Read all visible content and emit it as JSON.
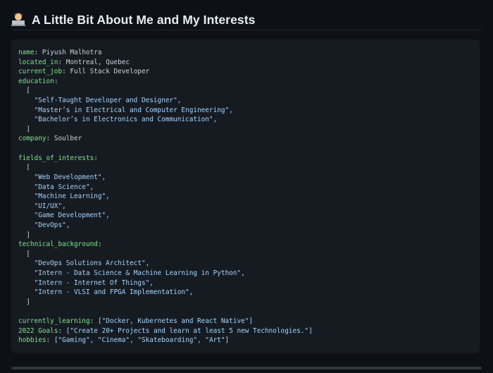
{
  "heading": {
    "emoji": "technologist-emoji",
    "title": "A Little Bit About Me and My Interests"
  },
  "code": {
    "name_key": "name",
    "name_value": "Piyush Malhotra",
    "located_key": "located_in",
    "located_value": "Montreal, Quebec",
    "job_key": "current_job",
    "job_value": "Full Stack Developer",
    "education_key": "education",
    "education": [
      "\"Self-Taught Developer and Designer\",",
      "\"Master’s in Electrical and Computer Engineering\",",
      "\"Bachelor’s in Electronics and Communication\","
    ],
    "company_key": "company",
    "company_value": "Soulber",
    "interests_key": "fields_of_interests",
    "interests": [
      "\"Web Development\",",
      "\"Data Science\",",
      "\"Machine Learning\",",
      "\"UI/UX\",",
      "\"Game Development\",",
      "\"DevOps\","
    ],
    "background_key": "technical_background",
    "background": [
      "\"DevOps Solutions Architect\",",
      "\"Intern - Data Science & Machine Learning in Python\",",
      "\"Intern - Internet Of Things\",",
      "\"Intern - VLSI and FPGA Implementation\","
    ],
    "learning_key": "currently_learning",
    "learning_value": "[\"Docker, Kubernetes and React Native\"]",
    "goals_key": "2022 Goals",
    "goals_value": "[\"Create 20+ Projects and learn at least 5 new Technologies.\"]",
    "hobbies_key": "hobbies",
    "hobbies_value": "[\"Gaming\", \"Cinema\", \"Skateboarding\", \"Art\"]",
    "open_bracket": "[",
    "close_bracket": "]",
    "colon": ":"
  },
  "colors": {
    "page_bg": "#0d1117",
    "code_bg": "#161b22",
    "key": "#7ee787",
    "string": "#a5d6ff",
    "text": "#c9d1d9"
  }
}
